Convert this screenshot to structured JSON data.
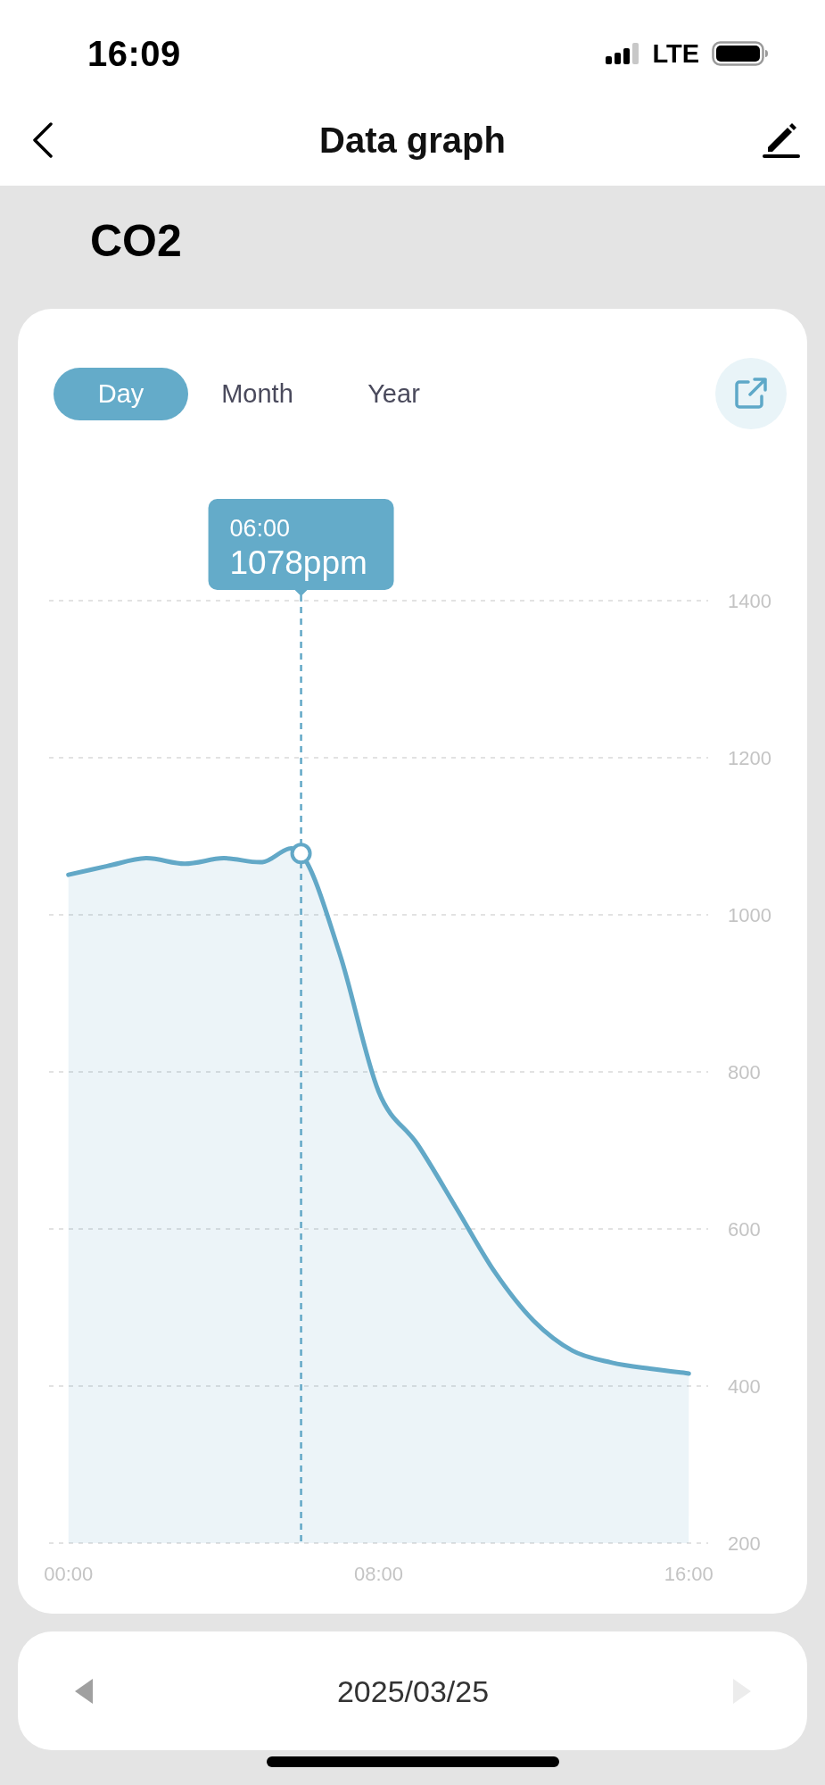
{
  "status_bar": {
    "time": "16:09",
    "network": "LTE"
  },
  "header": {
    "title": "Data graph"
  },
  "sensor": {
    "name": "CO2"
  },
  "chart_card": {
    "tabs": [
      {
        "label": "Day",
        "selected": true
      },
      {
        "label": "Month",
        "selected": false
      },
      {
        "label": "Year",
        "selected": false
      }
    ],
    "tooltip": {
      "time": "06:00",
      "value": "1078ppm"
    },
    "chart_data": {
      "type": "area",
      "x": [
        0,
        1,
        2,
        3,
        4,
        5,
        6,
        7,
        8,
        9,
        10,
        11,
        12,
        13,
        14,
        15,
        16
      ],
      "series": [
        {
          "color": "#62a8c7",
          "values": [
            1051,
            1062,
            1072,
            1065,
            1072,
            1067,
            1078,
            950,
            775,
            708,
            627,
            545,
            483,
            445,
            430,
            422,
            416
          ]
        }
      ],
      "xlim": [
        -0.5,
        16.5
      ],
      "ylim": [
        200,
        1400
      ],
      "xticks": [
        {
          "value": 0,
          "label": "00:00"
        },
        {
          "value": 8,
          "label": "08:00"
        },
        {
          "value": 16,
          "label": "16:00"
        }
      ],
      "yticks": [
        200,
        400,
        600,
        800,
        1000,
        1200,
        1400
      ],
      "grid": true,
      "ref_lines": [
        {
          "axis": "x",
          "value": 6
        }
      ]
    }
  },
  "date_nav": {
    "date": "2025/03/25",
    "previous": {
      "disabled": false
    },
    "next": {
      "disabled": true
    }
  }
}
